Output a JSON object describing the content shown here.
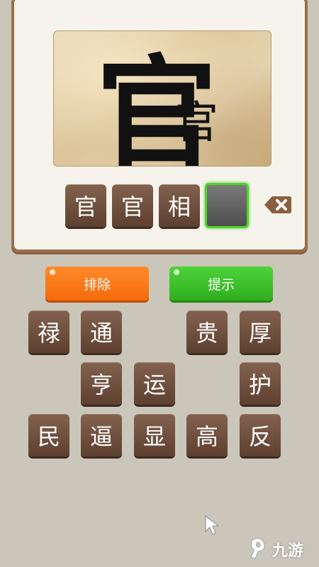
{
  "puzzle": {
    "big_glyph": "官",
    "small_glyph": "官"
  },
  "answer": {
    "slots": [
      "官",
      "官",
      "相",
      ""
    ]
  },
  "actions": {
    "remove_label": "排除",
    "hint_label": "提示"
  },
  "choices": {
    "row1": [
      "禄",
      "通",
      "贵",
      "厚"
    ],
    "row2": [
      "亨",
      "运",
      "护"
    ],
    "row3": [
      "民",
      "逼",
      "显",
      "高",
      "反"
    ]
  },
  "watermark": {
    "text": "九游"
  },
  "icons": {
    "delete": "backspace-x-icon",
    "cursor": "pointer-cursor-icon",
    "watermark_logo": "nine-game-logo-icon"
  },
  "colors": {
    "tile": "#6b4a38",
    "remove": "#f77a12",
    "hint": "#3cc52a",
    "selected_border": "#4fd32f"
  }
}
